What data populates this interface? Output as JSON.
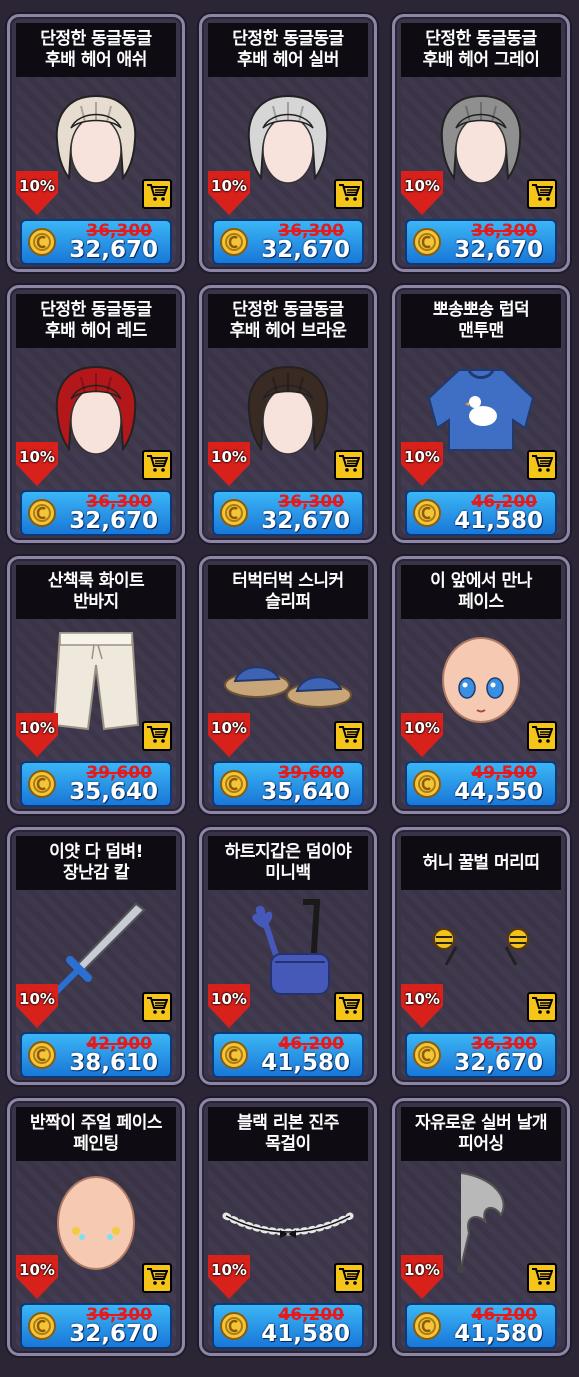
{
  "colors": {
    "background": "#2b2536",
    "card_border": "#8c86a6",
    "title_bar": "#0e0c12",
    "discount_red": "#d9211b",
    "cart_yellow": "#f5c518",
    "price_blue": "#1f8ee6",
    "old_price_red": "#e61a1a"
  },
  "items": [
    {
      "title_line1": "단정한 동글동글",
      "title_line2": "후배 헤어 애쉬",
      "discount": "10%",
      "old_price": "36,300",
      "new_price": "32,670",
      "icon": "hair-icon",
      "color": "#e6ddd0"
    },
    {
      "title_line1": "단정한 동글동글",
      "title_line2": "후배 헤어 실버",
      "discount": "10%",
      "old_price": "36,300",
      "new_price": "32,670",
      "icon": "hair-icon",
      "color": "#d6d6d6"
    },
    {
      "title_line1": "단정한 동글동글",
      "title_line2": "후배 헤어 그레이",
      "discount": "10%",
      "old_price": "36,300",
      "new_price": "32,670",
      "icon": "hair-icon",
      "color": "#8f8f8f"
    },
    {
      "title_line1": "단정한 동글동글",
      "title_line2": "후배 헤어 레드",
      "discount": "10%",
      "old_price": "36,300",
      "new_price": "32,670",
      "icon": "hair-icon",
      "color": "#b4171a"
    },
    {
      "title_line1": "단정한 동글동글",
      "title_line2": "후배 헤어 브라운",
      "discount": "10%",
      "old_price": "36,300",
      "new_price": "32,670",
      "icon": "hair-icon",
      "color": "#3a2a24"
    },
    {
      "title_line1": "뽀송뽀송 럽덕",
      "title_line2": "맨투맨",
      "discount": "10%",
      "old_price": "46,200",
      "new_price": "41,580",
      "icon": "sweatshirt-icon",
      "color": "#3f6fc4"
    },
    {
      "title_line1": "산책룩 화이트",
      "title_line2": "반바지",
      "discount": "10%",
      "old_price": "39,600",
      "new_price": "35,640",
      "icon": "shorts-icon",
      "color": "#efe8dc"
    },
    {
      "title_line1": "터벅터벅 스니커",
      "title_line2": "슬리퍼",
      "discount": "10%",
      "old_price": "39,600",
      "new_price": "35,640",
      "icon": "slippers-icon",
      "color": "#3e63b3"
    },
    {
      "title_line1": "이 앞에서 만나",
      "title_line2": "페이스",
      "discount": "10%",
      "old_price": "49,500",
      "new_price": "44,550",
      "icon": "face-icon",
      "color": "#f6c9b3"
    },
    {
      "title_line1": "이얏 다 덤벼!",
      "title_line2": "장난감 칼",
      "discount": "10%",
      "old_price": "42,900",
      "new_price": "38,610",
      "icon": "sword-icon",
      "color": "#2a6fd1"
    },
    {
      "title_line1": "하트지갑은 덤이야",
      "title_line2": "미니백",
      "discount": "10%",
      "old_price": "46,200",
      "new_price": "41,580",
      "icon": "bag-icon",
      "color": "#4658b8"
    },
    {
      "title_line1": "허니 꿀벌 머리띠",
      "title_line2": "",
      "discount": "10%",
      "old_price": "36,300",
      "new_price": "32,670",
      "icon": "headband-icon",
      "color": "#f2c21b"
    },
    {
      "title_line1": "반짝이 주얼 페이스",
      "title_line2": "페인팅",
      "discount": "10%",
      "old_price": "36,300",
      "new_price": "32,670",
      "icon": "face-paint-icon",
      "color": "#f6c9b3"
    },
    {
      "title_line1": "블랙 리본 진주",
      "title_line2": "목걸이",
      "discount": "10%",
      "old_price": "46,200",
      "new_price": "41,580",
      "icon": "necklace-icon",
      "color": "#e8e8e8"
    },
    {
      "title_line1": "자유로운 실버 날개",
      "title_line2": "피어싱",
      "discount": "10%",
      "old_price": "46,200",
      "new_price": "41,580",
      "icon": "earring-icon",
      "color": "#b8b8b8"
    }
  ]
}
